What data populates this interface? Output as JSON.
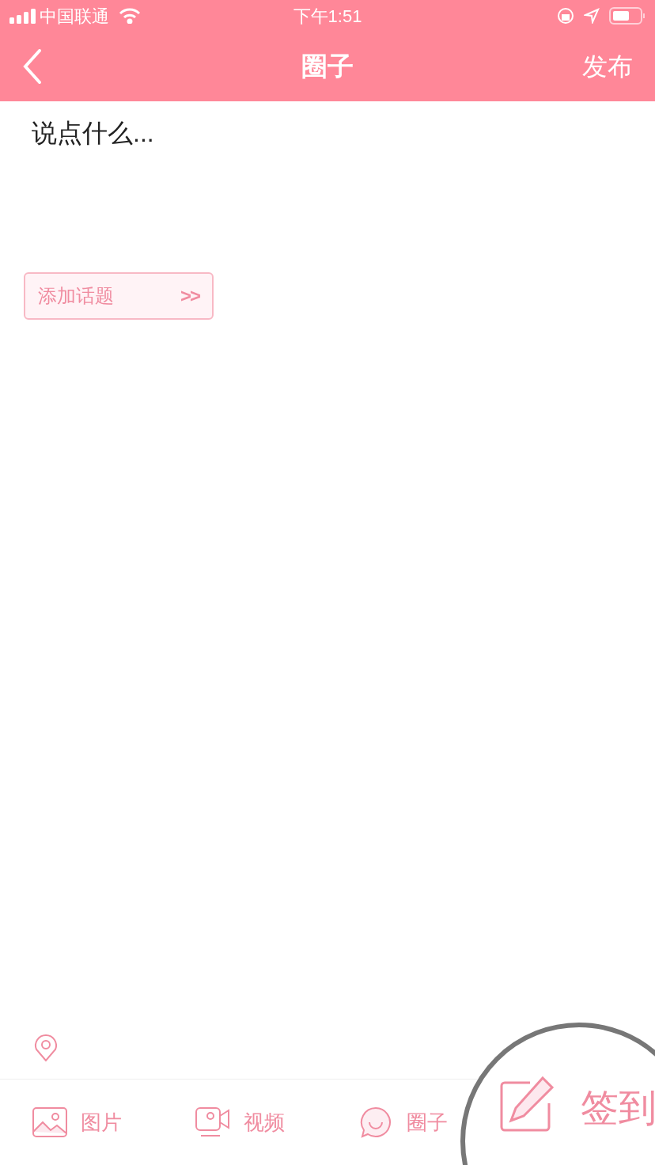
{
  "status_bar": {
    "carrier": "中国联通",
    "time": "下午1:51"
  },
  "nav": {
    "title": "圈子",
    "action": "发布"
  },
  "composer": {
    "placeholder": "说点什么..."
  },
  "topic_button": {
    "label": "添加话题",
    "arrow": ">>"
  },
  "toolbar": [
    {
      "kind": "image",
      "label": "图片"
    },
    {
      "kind": "video",
      "label": "视频"
    },
    {
      "kind": "circle",
      "label": "圈子"
    }
  ],
  "magnifier": {
    "kind": "checkin",
    "label": "签到"
  }
}
